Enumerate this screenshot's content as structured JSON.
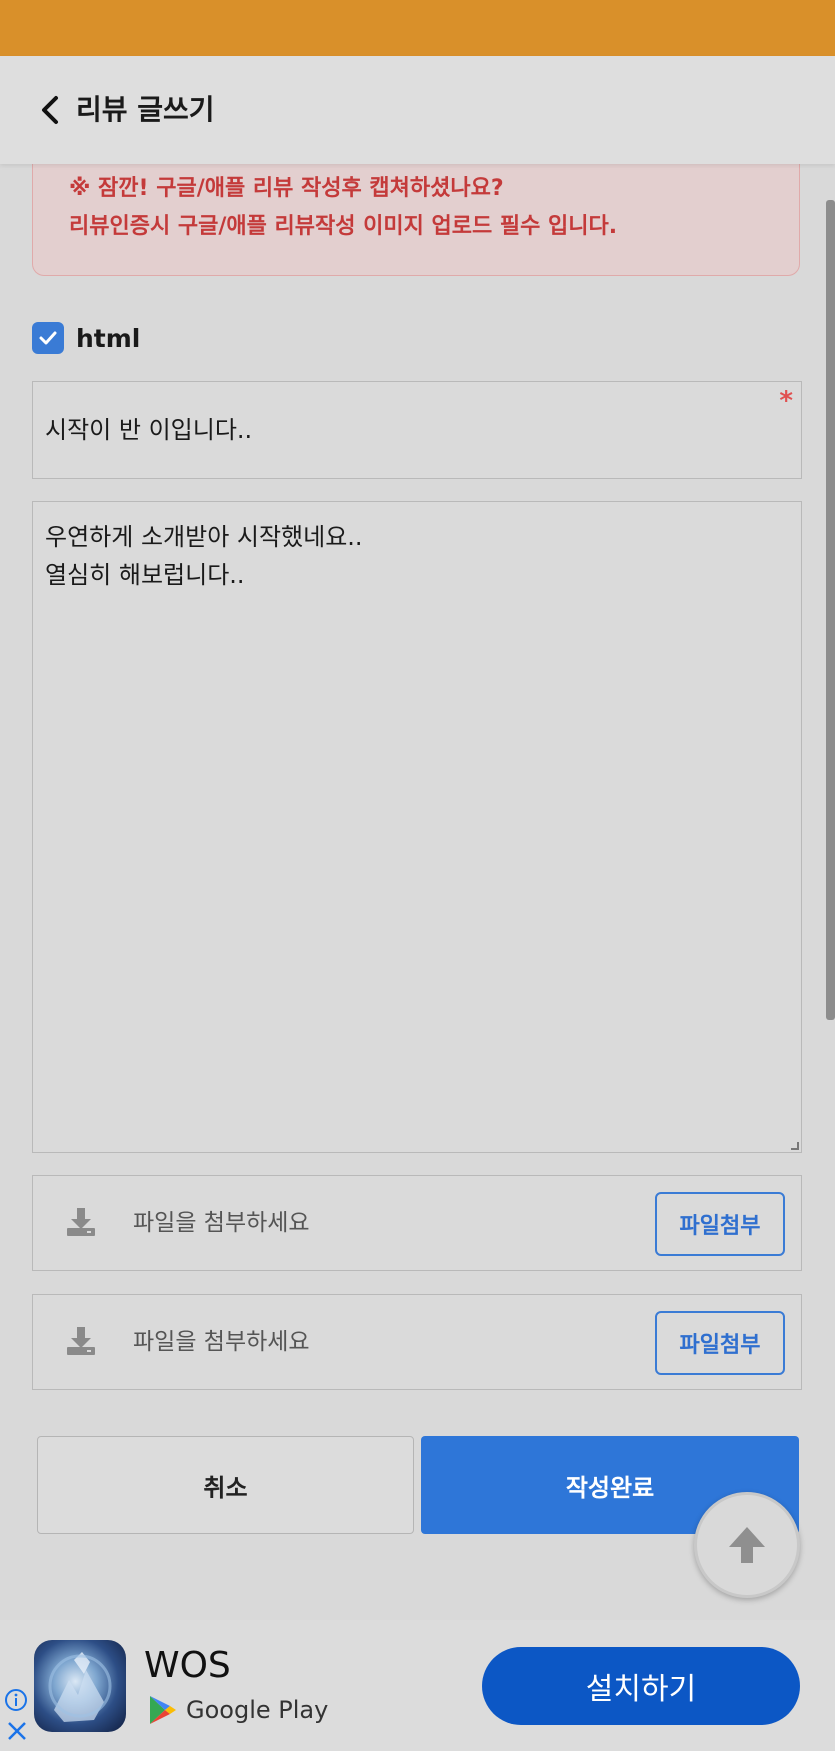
{
  "header": {
    "title": "리뷰 글쓰기",
    "back_icon": "chevron-left-icon"
  },
  "alert": {
    "line1": "※ 잠깐! 구글/애플 리뷰 작성후 캡쳐하셨나요?",
    "line2": "리뷰인증시 구글/애플 리뷰작성 이미지 업로드 필수 입니다.",
    "color": "#c43a3a"
  },
  "html_option": {
    "label": "html",
    "checked": true
  },
  "subject": {
    "value": "시작이 반 이입니다..",
    "required_mark": "*"
  },
  "content": {
    "lines": [
      "우연하게 소개받아 시작했네요..",
      "열심히 해보럽니다.."
    ]
  },
  "files": [
    {
      "placeholder": "파일을 첨부하세요",
      "button_label": "파일첨부",
      "icon": "download-icon"
    },
    {
      "placeholder": "파일을 첨부하세요",
      "button_label": "파일첨부",
      "icon": "download-icon"
    }
  ],
  "actions": {
    "cancel_label": "취소",
    "submit_label": "작성완료"
  },
  "ad": {
    "app_name": "WOS",
    "store_label": "Google Play",
    "install_label": "설치하기"
  },
  "colors": {
    "status_bar": "#d9902a",
    "accent": "#2e76d8",
    "ad_install": "#0c57c5"
  }
}
